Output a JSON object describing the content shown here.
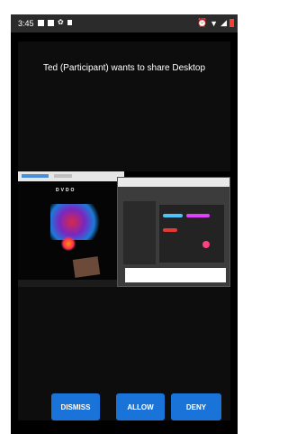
{
  "status_bar": {
    "time": "3:45"
  },
  "dialog": {
    "title": "Ted (Participant) wants to share Desktop"
  },
  "preview": {
    "brand": "DVDO"
  },
  "buttons": {
    "dismiss": "DISMISS",
    "allow": "ALLOW",
    "deny": "DENY"
  },
  "colors": {
    "button": "#1a73d9",
    "background": "#000000",
    "battery": "#ff3b30"
  }
}
